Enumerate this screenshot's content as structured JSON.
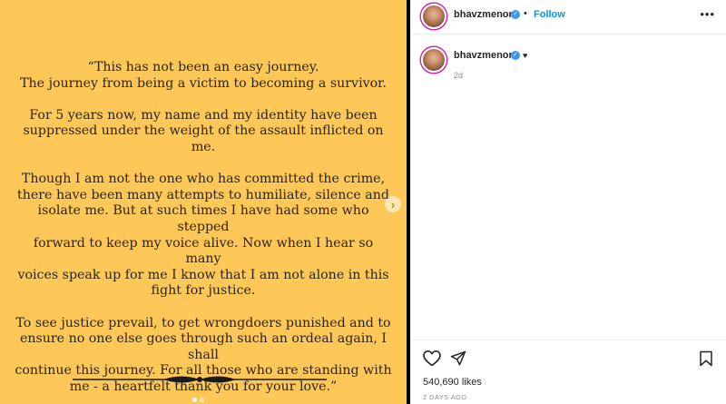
{
  "post_image": {
    "paragraphs": [
      "“This has not been an easy journey.\nThe journey from being a victim to becoming a survivor.",
      "For 5 years now, my name and my identity have been\nsuppressed under the weight of the assault inflicted on me.",
      "Though I am not the one who has committed the crime,\nthere have been many attempts to humiliate, silence and\nisolate me. But at such times I have had some who  stepped\nforward to keep my voice alive.  Now when I hear so many\nvoices speak up for me I know that I am not alone in this\nfight for justice.",
      "To see justice prevail, to get wrongdoers punished and to\nensure no one else goes through such an ordeal again, I shall\ncontinue this journey. For all those who are standing with\nme  - a heartfelt thank you for your love.”"
    ],
    "background_color": "#fec859",
    "next_icon": "chevron-right-icon",
    "carousel_dots": 2,
    "active_dot": 0
  },
  "header": {
    "username": "bhavzmenon",
    "separator": "•",
    "follow_label": "Follow",
    "more_icon": "more-horizontal-icon"
  },
  "caption": {
    "username": "bhavzmenon",
    "text": "♥",
    "time": "2d"
  },
  "actions": {
    "like_icon": "heart-icon",
    "share_icon": "send-icon",
    "save_icon": "bookmark-icon"
  },
  "stats": {
    "likes": "540,690 likes",
    "date": "2 DAYS AGO"
  },
  "colors": {
    "accent": "#0095f6",
    "verified": "#3897f0"
  }
}
